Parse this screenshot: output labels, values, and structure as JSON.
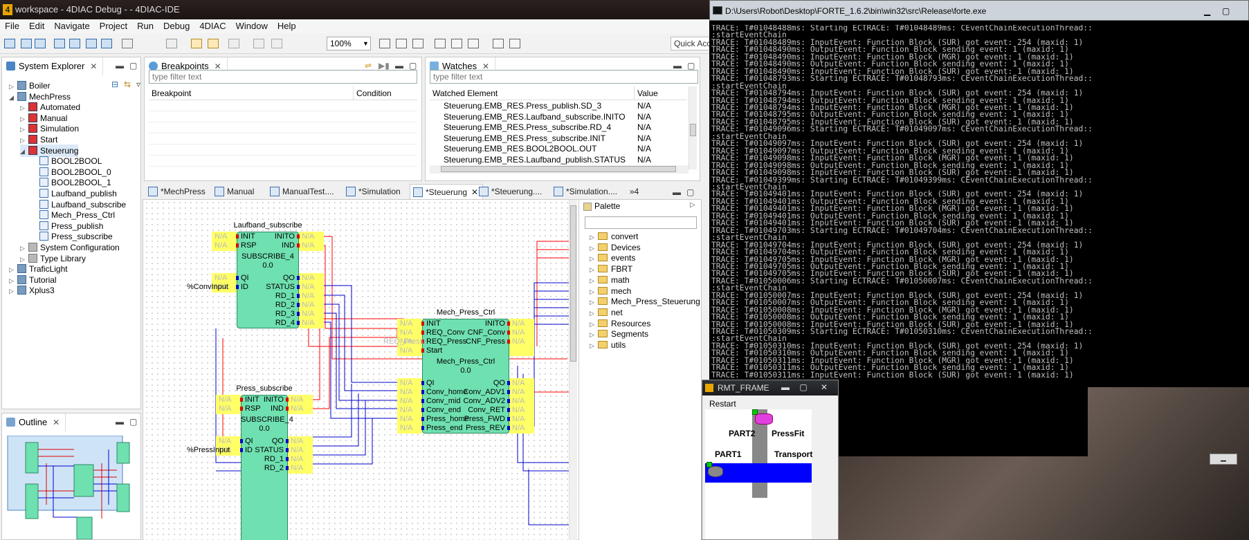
{
  "ide": {
    "title": "workspace - 4DIAC Debug - - 4DIAC-IDE",
    "logo": "4",
    "menu": [
      "File",
      "Edit",
      "Navigate",
      "Project",
      "Run",
      "Debug",
      "4DIAC",
      "Window",
      "Help"
    ],
    "zoom": "100%",
    "quick_access": "Quick Access"
  },
  "system_explorer": {
    "tab": "System Explorer",
    "tree": [
      {
        "label": "Boiler",
        "level": 0,
        "arrow": "▷",
        "icon": "proj"
      },
      {
        "label": "MechPress",
        "level": 0,
        "arrow": "◢",
        "icon": "proj"
      },
      {
        "label": "Automated",
        "level": 1,
        "arrow": "▷",
        "icon": "app"
      },
      {
        "label": "Manual",
        "level": 1,
        "arrow": "▷",
        "icon": "app"
      },
      {
        "label": "Simulation",
        "level": 1,
        "arrow": "▷",
        "icon": "app"
      },
      {
        "label": "Start",
        "level": 1,
        "arrow": "▷",
        "icon": "app"
      },
      {
        "label": "Steuerung",
        "level": 1,
        "arrow": "◢",
        "icon": "app"
      },
      {
        "label": "BOOL2BOOL",
        "level": 2,
        "arrow": "",
        "icon": "fb"
      },
      {
        "label": "BOOL2BOOL_0",
        "level": 2,
        "arrow": "",
        "icon": "fb"
      },
      {
        "label": "BOOL2BOOL_1",
        "level": 2,
        "arrow": "",
        "icon": "fb"
      },
      {
        "label": "Laufband_publish",
        "level": 2,
        "arrow": "",
        "icon": "fb"
      },
      {
        "label": "Laufband_subscribe",
        "level": 2,
        "arrow": "",
        "icon": "fb"
      },
      {
        "label": "Mech_Press_Ctrl",
        "level": 2,
        "arrow": "",
        "icon": "fb"
      },
      {
        "label": "Press_publish",
        "level": 2,
        "arrow": "",
        "icon": "fb"
      },
      {
        "label": "Press_subscribe",
        "level": 2,
        "arrow": "",
        "icon": "fb"
      },
      {
        "label": "System Configuration",
        "level": 1,
        "arrow": "▷",
        "icon": "sys"
      },
      {
        "label": "Type Library",
        "level": 1,
        "arrow": "▷",
        "icon": "sys"
      },
      {
        "label": "TraficLight",
        "level": 0,
        "arrow": "▷",
        "icon": "proj"
      },
      {
        "label": "Tutorial",
        "level": 0,
        "arrow": "▷",
        "icon": "proj"
      },
      {
        "label": "Xplus3",
        "level": 0,
        "arrow": "▷",
        "icon": "proj"
      }
    ]
  },
  "outline": {
    "tab": "Outline"
  },
  "breakpoints": {
    "tab": "Breakpoints",
    "filter_placeholder": "type filter text",
    "col_breakpoint": "Breakpoint",
    "col_condition": "Condition"
  },
  "watches": {
    "tab": "Watches",
    "filter_placeholder": "type filter text",
    "col_element": "Watched Element",
    "col_value": "Value",
    "rows": [
      {
        "element": "Steuerung.EMB_RES.Press_publish.SD_3",
        "value": "N/A"
      },
      {
        "element": "Steuerung.EMB_RES.Laufband_subscribe.INITO",
        "value": "N/A"
      },
      {
        "element": "Steuerung.EMB_RES.Press_subscribe.RD_4",
        "value": "N/A"
      },
      {
        "element": "Steuerung.EMB_RES.Press_subscribe.INIT",
        "value": "N/A"
      },
      {
        "element": "Steuerung.EMB_RES.BOOL2BOOL.OUT",
        "value": "N/A"
      },
      {
        "element": "Steuerung.EMB_RES.Laufband_publish.STATUS",
        "value": "N/A"
      }
    ]
  },
  "editor_tabs": [
    "*MechPress",
    "Manual",
    "ManualTest....",
    "*Simulation",
    "*Steuerung",
    "*Steuerung....",
    "*Simulation....",
    "»4"
  ],
  "fbs": {
    "laufband": {
      "name": "Laufband_subscribe",
      "type": "SUBSCRIBE_4",
      "version": "0.0",
      "ev_in": [
        "INIT",
        "RSP"
      ],
      "ev_out": [
        "INITO",
        "IND"
      ],
      "data_in": [
        "QI",
        "ID"
      ],
      "data_out": [
        "QO",
        "STATUS",
        "RD_1",
        "RD_2",
        "RD_3",
        "RD_4"
      ],
      "id_value": "%ConvInput"
    },
    "mech": {
      "name": "Mech_Press_Ctrl",
      "type": "Mech_Press_Ctrl",
      "version": "0.0",
      "ev_in": [
        "INIT",
        "REQ_Conv",
        "REQ_Press",
        "Start"
      ],
      "ev_out": [
        "INITO",
        "CNF_Conv",
        "CNF_Press"
      ],
      "data_in": [
        "QI",
        "Conv_home",
        "Conv_mid",
        "Conv_end",
        "Press_home",
        "Press_end"
      ],
      "data_out": [
        "QO",
        "Conv_ADV1",
        "Conv_ADV2",
        "Conv_RET",
        "Press_FWD",
        "Press_REV"
      ],
      "req_press_value": "REQ_Press"
    },
    "press": {
      "name": "Press_subscribe",
      "type": "SUBSCRIBE_4",
      "version": "0.0",
      "ev_in": [
        "INIT",
        "RSP"
      ],
      "ev_out": [
        "INITO",
        "IND"
      ],
      "data_in": [
        "QI",
        "ID"
      ],
      "data_out": [
        "QO",
        "STATUS",
        "RD_1",
        "RD_2"
      ],
      "id_value": "%PressInput"
    },
    "na": "N/A"
  },
  "palette": {
    "title": "Palette",
    "items": [
      "convert",
      "Devices",
      "events",
      "FBRT",
      "math",
      "mech",
      "Mech_Press_Steuerung",
      "net",
      "Resources",
      "Segments",
      "utils"
    ]
  },
  "console": {
    "title": "D:\\Users\\Robot\\Desktop\\FORTE_1.6.2\\bin\\win32\\src\\Release\\forte.exe",
    "lines": [
      "TRACE: T#01048488ms: Starting ECTRACE: T#01048489ms: CEventChainExecutionThread::",
      ":startEventChain",
      "TRACE: T#01048489ms: InputEvent: Function Block (SUR) got event: 254 (maxid: 1)",
      "TRACE: T#01048490ms: OutputEvent: Function Block sending event: 1 (maxid: 1)",
      "TRACE: T#01048490ms: InputEvent: Function Block (MGR) got event: 1 (maxid: 1)",
      "TRACE: T#01048490ms: OutputEvent: Function Block sending event: 1 (maxid: 1)",
      "TRACE: T#01048490ms: InputEvent: Function Block (SUR) got event: 1 (maxid: 1)",
      "TRACE: T#01048793ms: Starting ECTRACE: T#01048793ms: CEventChainExecutionThread::",
      ":startEventChain",
      "TRACE: T#01048794ms: InputEvent: Function Block (SUR) got event: 254 (maxid: 1)",
      "TRACE: T#01048794ms: OutputEvent: Function Block sending event: 1 (maxid: 1)",
      "TRACE: T#01048794ms: InputEvent: Function Block (MGR) got event: 1 (maxid: 1)",
      "TRACE: T#01048795ms: OutputEvent: Function Block sending event: 1 (maxid: 1)",
      "TRACE: T#01048795ms: InputEvent: Function Block (SUR) got event: 1 (maxid: 1)",
      "TRACE: T#01049096ms: Starting ECTRACE: T#01049097ms: CEventChainExecutionThread::",
      ":startEventChain",
      "TRACE: T#01049097ms: InputEvent: Function Block (SUR) got event: 254 (maxid: 1)",
      "TRACE: T#01049097ms: OutputEvent: Function Block sending event: 1 (maxid: 1)",
      "TRACE: T#01049098ms: InputEvent: Function Block (MGR) got event: 1 (maxid: 1)",
      "TRACE: T#01049098ms: OutputEvent: Function Block sending event: 1 (maxid: 1)",
      "TRACE: T#01049098ms: InputEvent: Function Block (SUR) got event: 1 (maxid: 1)",
      "TRACE: T#01049399ms: Starting ECTRACE: T#01049399ms: CEventChainExecutionThread::",
      ":startEventChain",
      "TRACE: T#01049401ms: InputEvent: Function Block (SUR) got event: 254 (maxid: 1)",
      "TRACE: T#01049401ms: OutputEvent: Function Block sending event: 1 (maxid: 1)",
      "TRACE: T#01049401ms: InputEvent: Function Block (MGR) got event: 1 (maxid: 1)",
      "TRACE: T#01049401ms: OutputEvent: Function Block sending event: 1 (maxid: 1)",
      "TRACE: T#01049401ms: InputEvent: Function Block (SUR) got event: 1 (maxid: 1)",
      "TRACE: T#01049703ms: Starting ECTRACE: T#01049704ms: CEventChainExecutionThread::",
      ":startEventChain",
      "TRACE: T#01049704ms: InputEvent: Function Block (SUR) got event: 254 (maxid: 1)",
      "TRACE: T#01049704ms: OutputEvent: Function Block sending event: 1 (maxid: 1)",
      "TRACE: T#01049705ms: InputEvent: Function Block (MGR) got event: 1 (maxid: 1)",
      "TRACE: T#01049705ms: OutputEvent: Function Block sending event: 1 (maxid: 1)",
      "TRACE: T#01049705ms: InputEvent: Function Block (SUR) got event: 1 (maxid: 1)",
      "TRACE: T#01050006ms: Starting ECTRACE: T#01050007ms: CEventChainExecutionThread::",
      ":startEventChain",
      "TRACE: T#01050007ms: InputEvent: Function Block (SUR) got event: 254 (maxid: 1)",
      "TRACE: T#01050007ms: OutputEvent: Function Block sending event: 1 (maxid: 1)",
      "TRACE: T#01050008ms: InputEvent: Function Block (MGR) got event: 1 (maxid: 1)",
      "TRACE: T#01050008ms: OutputEvent: Function Block sending event: 1 (maxid: 1)",
      "TRACE: T#01050008ms: InputEvent: Function Block (SUR) got event: 1 (maxid: 1)",
      "TRACE: T#01050309ms: Starting ECTRACE: T#01050310ms: CEventChainExecutionThread::",
      ":startEventChain",
      "TRACE: T#01050310ms: InputEvent: Function Block (SUR) got event: 254 (maxid: 1)",
      "TRACE: T#01050310ms: OutputEvent: Function Block sending event: 1 (maxid: 1)",
      "TRACE: T#01050311ms: InputEvent: Function Block (MGR) got event: 1 (maxid: 1)",
      "TRACE: T#01050311ms: OutputEvent: Function Block sending event: 1 (maxid: 1)",
      "TRACE: T#01050311ms: InputEvent: Function Block (SUR) got event: 1 (maxid: 1)"
    ]
  },
  "rmt": {
    "title": "RMT_FRAME",
    "restart": "Restart",
    "part2": "PART2",
    "pressfit": "PressFit",
    "part1": "PART1",
    "transport": "Transport"
  },
  "colors": {
    "fb_fill": "#6fe0b0",
    "event_line": "#ff0000",
    "data_line": "#0000cc",
    "pin_highlight": "#ffff66"
  }
}
